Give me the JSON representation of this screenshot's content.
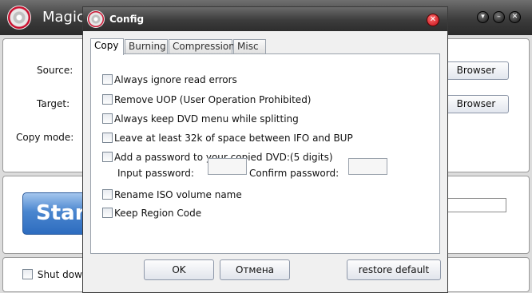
{
  "main": {
    "title": "Magic",
    "source_label": "Source:",
    "target_label": "Target:",
    "copy_mode_label": "Copy mode:",
    "browse_label": "Browser",
    "start_label": "Start",
    "shutdown_label": "Shut down"
  },
  "dialog": {
    "title": "Config",
    "close_glyph": "✕",
    "tabs": [
      {
        "label": "Copy",
        "active": true
      },
      {
        "label": "Burning",
        "active": false
      },
      {
        "label": "Compression",
        "active": false
      },
      {
        "label": "Misc",
        "active": false
      }
    ],
    "options": [
      "Always ignore read errors",
      "Remove UOP (User Operation Prohibited)",
      "Always keep DVD menu while splitting",
      "Leave at least 32k of space between IFO and BUP",
      "Add a password to your copied DVD:(5 digits)",
      "Rename ISO volume name",
      "Keep Region Code"
    ],
    "input_password_label": "Input password:",
    "confirm_password_label": "Confirm password:",
    "buttons": {
      "ok": "OK",
      "cancel": "Отмена",
      "restore": "restore default"
    }
  },
  "colors": {
    "titlebar": "#3c3c3c",
    "start_button": "#4a86cf",
    "close_button": "#c4101a"
  }
}
